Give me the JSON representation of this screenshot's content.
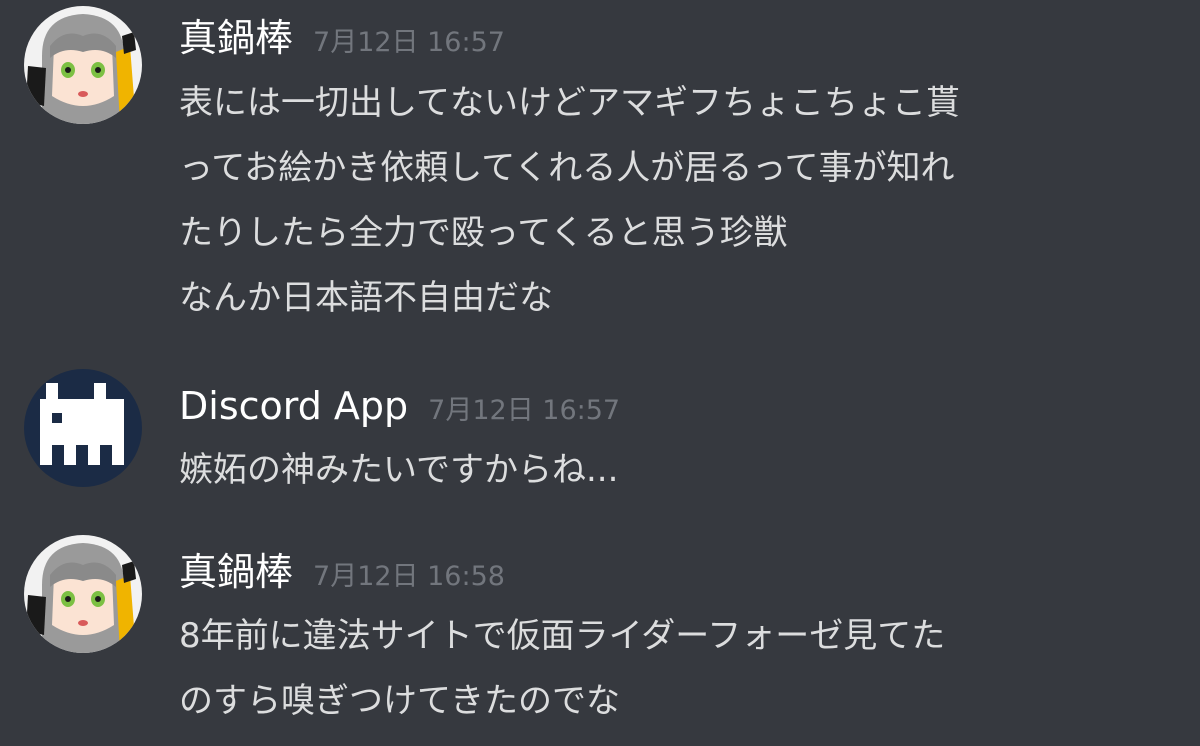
{
  "messages": [
    {
      "author": "真鍋棒",
      "timestamp": "7月12日 16:57",
      "avatar_icon": "anime-girl-avatar",
      "lines": [
        "表には一切出してないけどアマギフちょこちょこ貰",
        "ってお絵かき依頼してくれる人が居るって事が知れ",
        "たりしたら全力で殴ってくると思う珍獣",
        "なんか日本語不自由だな"
      ]
    },
    {
      "author": "Discord App",
      "timestamp": "7月12日 16:57",
      "avatar_icon": "pixel-creature-avatar",
      "lines": [
        "嫉妬の神みたいですからね..."
      ]
    },
    {
      "author": "真鍋棒",
      "timestamp": "7月12日 16:58",
      "avatar_icon": "anime-girl-avatar",
      "lines": [
        "8年前に違法サイトで仮面ライダーフォーゼ見てた",
        "のすら嗅ぎつけてきたのでな"
      ]
    }
  ],
  "colors": {
    "background": "#36393f",
    "username": "#ffffff",
    "timestamp": "#72767d",
    "message_text": "#dcddde"
  }
}
